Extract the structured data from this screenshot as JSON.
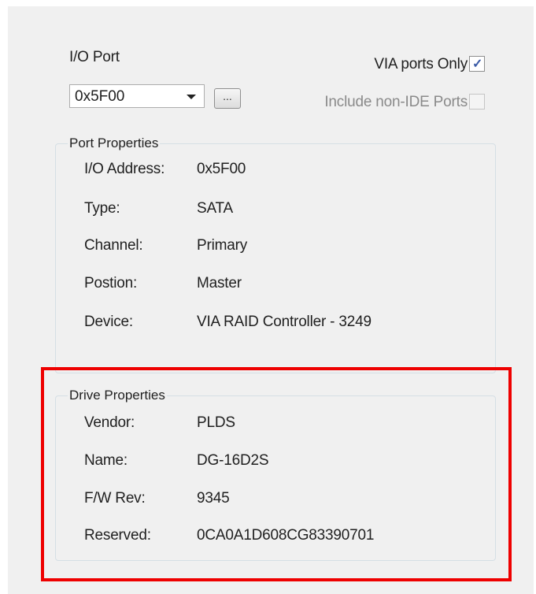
{
  "io_port": {
    "label": "I/O Port",
    "selected_value": "0x5F00",
    "browse_label": "..."
  },
  "options": {
    "via_only_label": "VIA ports Only",
    "via_only_checked": true,
    "non_ide_label": "Include non-IDE Ports",
    "non_ide_checked": false,
    "checkmark": "✓"
  },
  "port_properties": {
    "title": "Port Properties",
    "rows": [
      {
        "label": "I/O Address:",
        "value": "0x5F00"
      },
      {
        "label": "Type:",
        "value": "SATA"
      },
      {
        "label": "Channel:",
        "value": "Primary"
      },
      {
        "label": "Postion:",
        "value": "Master"
      },
      {
        "label": "Device:",
        "value": "VIA RAID Controller - 3249"
      }
    ]
  },
  "drive_properties": {
    "title": "Drive Properties",
    "rows": [
      {
        "label": "Vendor:",
        "value": "PLDS"
      },
      {
        "label": "Name:",
        "value": "DG-16D2S"
      },
      {
        "label": "F/W Rev:",
        "value": "9345"
      },
      {
        "label": "Reserved:",
        "value": "0CA0A1D608CG83390701"
      }
    ]
  },
  "colors": {
    "highlight": "#ee0000",
    "dialog_bg": "#f0f0f0"
  }
}
